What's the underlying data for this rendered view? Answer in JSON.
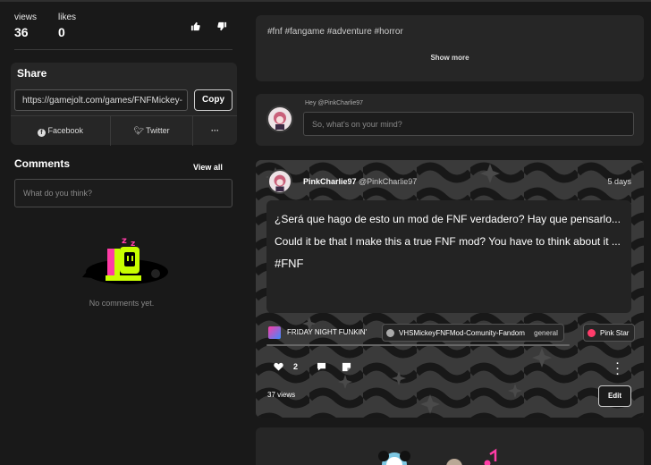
{
  "stats": {
    "views_label": "views",
    "views_value": "36",
    "likes_label": "likes",
    "likes_value": "0"
  },
  "share": {
    "title": "Share",
    "url": "https://gamejolt.com/games/FNFMickey-",
    "copy_label": "Copy",
    "facebook_label": "Facebook",
    "twitter_label": "Twitter",
    "more_label": "···"
  },
  "comments": {
    "title": "Comments",
    "view_all": "View all",
    "placeholder": "What do you think?",
    "empty_text": "No comments yet."
  },
  "description": {
    "tags": "#fnf #fangame #adventure #horror",
    "show_more": "Show more"
  },
  "composer": {
    "hey": "Hey @PinkCharlie97",
    "placeholder": "So, what's on your mind?"
  },
  "post": {
    "author_name": "PinkCharlie97",
    "author_handle": "@PinkCharlie97",
    "time": "5 days",
    "paragraph_1": "¿Será que hago de esto un mod de FNF verdadero? Hay que pensarlo...",
    "paragraph_2": "Could it be that I make this a true FNF mod? You have to think about it ...",
    "hashtag": "#FNF",
    "chips": [
      "FRIDAY NIGHT FUNKIN'",
      "VHSMickeyFNFMod-Comunity-Fandom",
      "general",
      "Pink Star"
    ],
    "like_count": "2",
    "views": "37 views",
    "edit_label": "Edit"
  },
  "colors": {
    "background": "#191919",
    "card": "#262626",
    "accent_lime": "#c8ff00",
    "accent_pink": "#ff3ca6"
  }
}
